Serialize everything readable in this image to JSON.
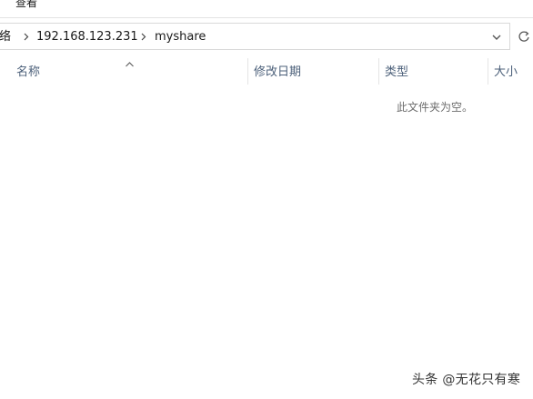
{
  "ribbon": {
    "view_tab": "查看"
  },
  "address_bar": {
    "crumbs": [
      "网络",
      "192.168.123.231",
      "myshare"
    ]
  },
  "file_list": {
    "columns": [
      "名称",
      "修改日期",
      "类型",
      "大小"
    ],
    "sorted_by": "名称",
    "empty_message": "此文件夹为空。"
  },
  "watermark": {
    "text": "头条 @无花只有寒"
  },
  "colors": {
    "column_header_text": "#4c607a",
    "empty_message_text": "#6d6d6d",
    "border": "#d9d9d9"
  }
}
